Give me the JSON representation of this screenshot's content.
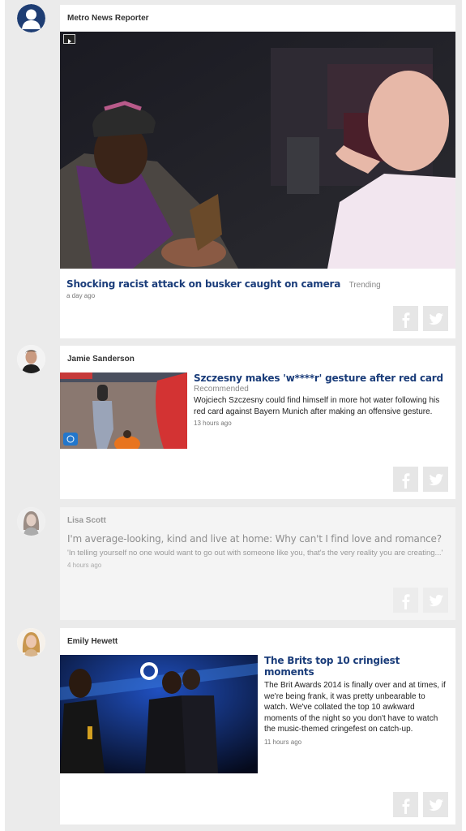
{
  "posts": [
    {
      "author": "Metro News Reporter",
      "title": "Shocking racist attack on busker caught on camera",
      "tag": "Trending",
      "time": "a day ago",
      "media": "video"
    },
    {
      "author": "Jamie Sanderson",
      "title": "Szczesny makes 'w****r' gesture after red card",
      "tag": "Recommended",
      "excerpt": "Wojciech Szczesny could find himself in more hot water following his red card against Bayern Munich after making an offensive gesture.",
      "time": "13 hours ago"
    },
    {
      "author": "Lisa Scott",
      "title": "I'm average-looking, kind and live at home: Why can't I find love and romance?",
      "excerpt": "'In telling yourself no one would want to go out with someone like you, that's the very reality you are creating...'",
      "time": "4 hours ago"
    },
    {
      "author": "Emily Hewett",
      "title": "The Brits top 10 cringiest moments",
      "excerpt": "The Brit Awards 2014 is finally over and at times, if we're being frank, it was pretty unbearable to watch. We've collated the top 10 awkward moments of the night so you don't have to watch the music-themed cringefest on catch-up.",
      "time": "11 hours ago"
    }
  ],
  "icons": {
    "facebook": "facebook-icon",
    "twitter": "twitter-icon",
    "play": "play-icon"
  },
  "colors": {
    "title": "#1b3d7a",
    "background": "#ebebeb",
    "card": "#ffffff"
  }
}
